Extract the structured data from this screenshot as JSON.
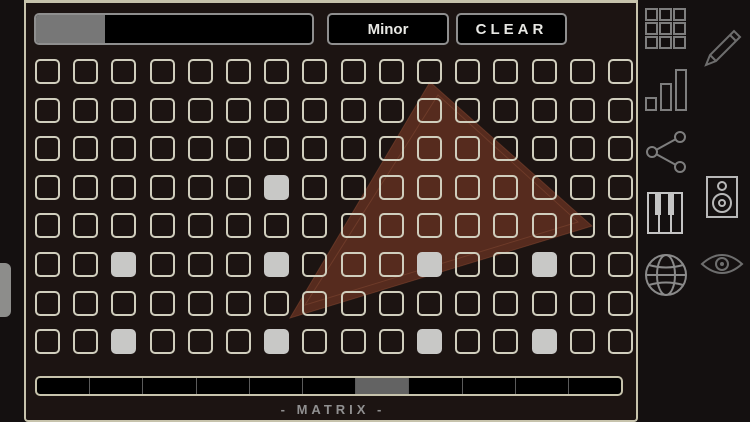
{
  "toolbar": {
    "progress_fraction": 0.25,
    "scale_label": "Minor",
    "clear_label": "CLEAR"
  },
  "matrix": {
    "rows": 8,
    "cols": 16,
    "active_cells": [
      [
        3,
        6
      ],
      [
        5,
        2
      ],
      [
        5,
        6
      ],
      [
        5,
        10
      ],
      [
        5,
        13
      ],
      [
        7,
        2
      ],
      [
        7,
        6
      ],
      [
        7,
        10
      ],
      [
        7,
        13
      ]
    ]
  },
  "timeline": {
    "segments": 11,
    "active_segment": 6
  },
  "panel_label": "- MATRIX -",
  "sidebar": {
    "icons": [
      "grid-icon",
      "pencil-icon",
      "bar-chart-icon",
      "share-icon",
      "speaker-icon",
      "piano-icon",
      "globe-icon",
      "eye-icon"
    ]
  },
  "colors": {
    "background": "#141010",
    "panel_border": "#c7c3ac",
    "triangle": "#7a3a26",
    "cell_on": "#c8c8c6"
  }
}
